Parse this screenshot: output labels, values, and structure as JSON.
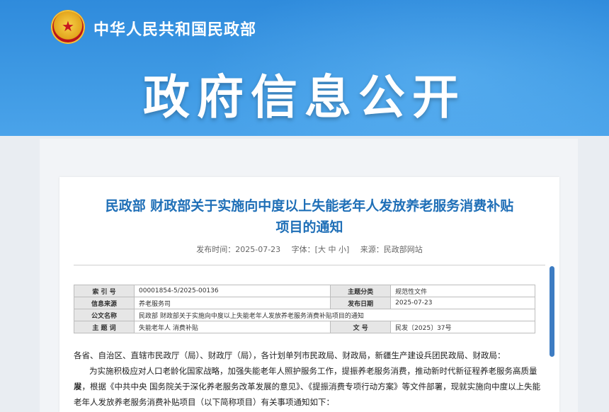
{
  "header": {
    "ministry_name": "中华人民共和国民政部",
    "banner_title": "政府信息公开"
  },
  "article": {
    "title_line1": "民政部 财政部关于实施向中度以上失能老年人发放养老服务消费补贴",
    "title_line2": "项目的通知",
    "meta": {
      "publish_label": "发布时间：",
      "publish_date": "2025-07-23",
      "font_label": "字体：",
      "font_options": "[大 中 小]",
      "source_label": "来源：",
      "source_value": "民政部网站"
    },
    "info_table": {
      "index_label": "索 引 号",
      "index_value": "00001854-5/2025-00136",
      "category_label": "主题分类",
      "category_value": "规范性文件",
      "info_source_label": "信息来源",
      "info_source_value": "养老服务司",
      "publish_date_label": "发布日期",
      "publish_date_value": "2025-07-23",
      "doc_name_label": "公文名称",
      "doc_name_value": "民政部 财政部关于实施向中度以上失能老年人发放养老服务消费补贴项目的通知",
      "keywords_label": "主 题 词",
      "keywords_value": "失能老年人 消费补贴",
      "doc_no_label": "文 号",
      "doc_no_value": "民发〔2025〕37号"
    },
    "body": {
      "addressee": "各省、自治区、直辖市民政厅（局）、财政厅（局），各计划单列市民政局、财政局，新疆生产建设兵团民政局、财政局：",
      "paragraph1_line1": "为实施积极应对人口老龄化国家战略，加强失能老年人照护服务工作，提振养老服务消费，推动新时代新征程养老服务高质量发",
      "paragraph1_line2": "展，根据《中共中央 国务院关于深化养老服务改革发展的意见》、《提振消费专项行动方案》等文件部署，现就实施向中度以上失能",
      "paragraph1_line3": "老年人发放养老服务消费补贴项目（以下简称项目）有关事项通知如下："
    }
  },
  "colors": {
    "banner_blue": "#3f9ae4",
    "title_blue": "#1f6fb7",
    "scrollbar_blue": "#3d7cc2"
  }
}
